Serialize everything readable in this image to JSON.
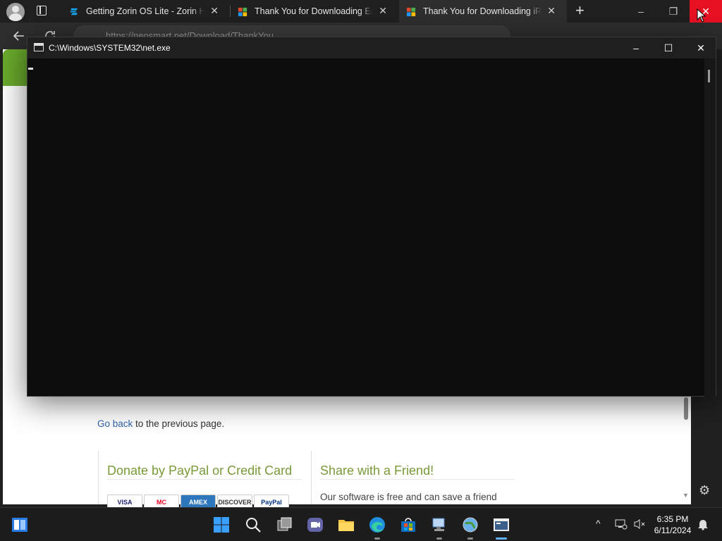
{
  "browser": {
    "tabs": [
      {
        "title": "Getting Zorin OS Lite - Zorin Hel",
        "close": "✕",
        "active": false
      },
      {
        "title": "Thank You for Downloading Easy",
        "close": "✕",
        "active": false
      },
      {
        "title": "Thank You for Downloading iRef",
        "close": "✕",
        "active": true
      }
    ],
    "new_tab": "+",
    "address": "https://neosmart.net/Download/ThankYou",
    "window_controls": {
      "minimize": "–",
      "restore": "❐",
      "close": "✕"
    }
  },
  "page": {
    "go_back_link": "Go back",
    "go_back_rest": " to the previous page.",
    "donate_title": "Donate by PayPal or Credit Card",
    "share_title": "Share with a Friend!",
    "share_text": "Our software is free and can save a friend",
    "cards": [
      "VISA",
      "MC",
      "AMEX",
      "DISCOVER",
      "PayPal"
    ]
  },
  "console": {
    "title": "C:\\Windows\\SYSTEM32\\net.exe",
    "controls": {
      "minimize": "–",
      "maximize": "☐",
      "close": "✕"
    }
  },
  "taskbar": {
    "time": "6:35 PM",
    "date": "6/11/2024"
  },
  "colors": {
    "accent_green": "#6aaa2c",
    "close_red": "#e81123",
    "link_blue": "#3462ae",
    "title_green": "#7a9a3a"
  }
}
